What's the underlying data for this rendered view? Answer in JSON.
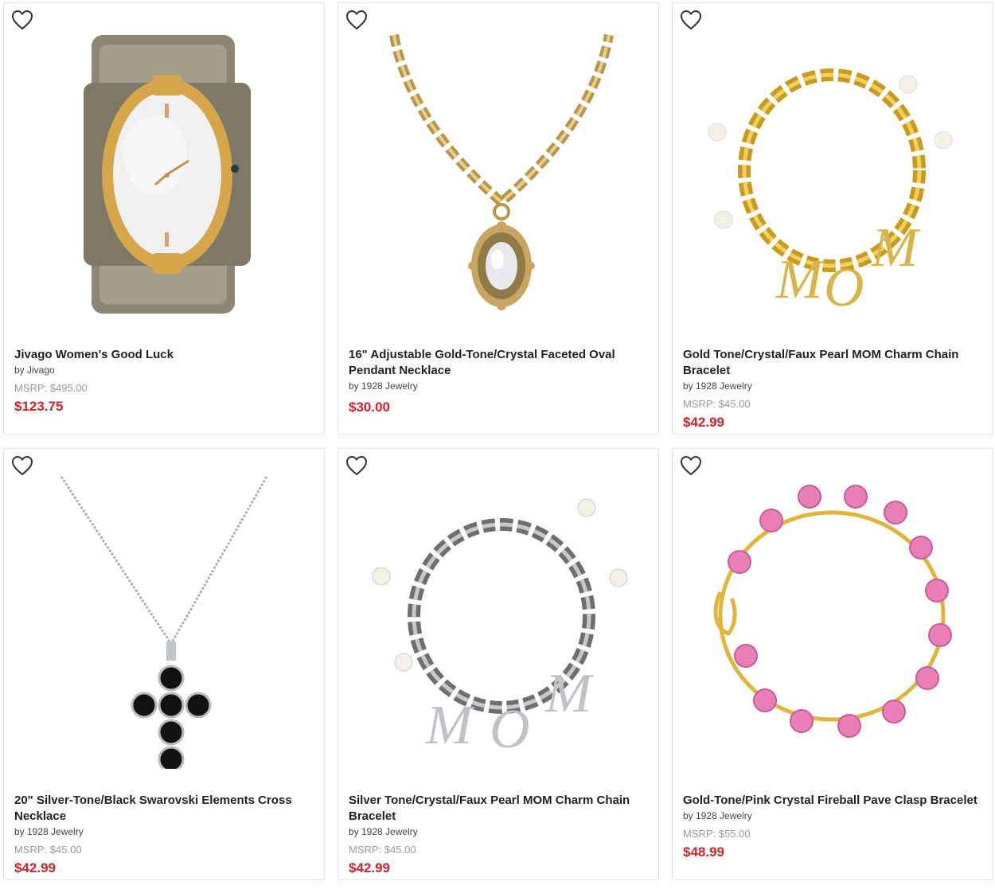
{
  "products": [
    {
      "title": "Jivago Women's Good Luck",
      "brand": "by Jivago",
      "msrp": "MSRP: $495.00",
      "price": "$123.75"
    },
    {
      "title": "16\" Adjustable Gold-Tone/Crystal Faceted Oval Pendant Necklace",
      "brand": "by 1928 Jewelry",
      "msrp": "",
      "price": "$30.00"
    },
    {
      "title": "Gold Tone/Crystal/Faux Pearl MOM Charm Chain Bracelet",
      "brand": "by 1928 Jewelry",
      "msrp": "MSRP: $45.00",
      "price": "$42.99"
    },
    {
      "title": "20\" Silver-Tone/Black Swarovski Elements Cross Necklace",
      "brand": "by 1928 Jewelry",
      "msrp": "MSRP: $45.00",
      "price": "$42.99"
    },
    {
      "title": "Silver Tone/Crystal/Faux Pearl MOM Charm Chain Bracelet",
      "brand": "by 1928 Jewelry",
      "msrp": "MSRP: $45.00",
      "price": "$42.99"
    },
    {
      "title": "Gold-Tone/Pink Crystal Fireball Pave Clasp Bracelet",
      "brand": "by 1928 Jewelry",
      "msrp": "MSRP: $55.00",
      "price": "$48.99"
    }
  ],
  "icons": {
    "wishlist": "heart-outline-icon"
  },
  "colors": {
    "price": "#d2232a",
    "msrp": "#9a9a9a",
    "border": "#e3e3e3"
  }
}
